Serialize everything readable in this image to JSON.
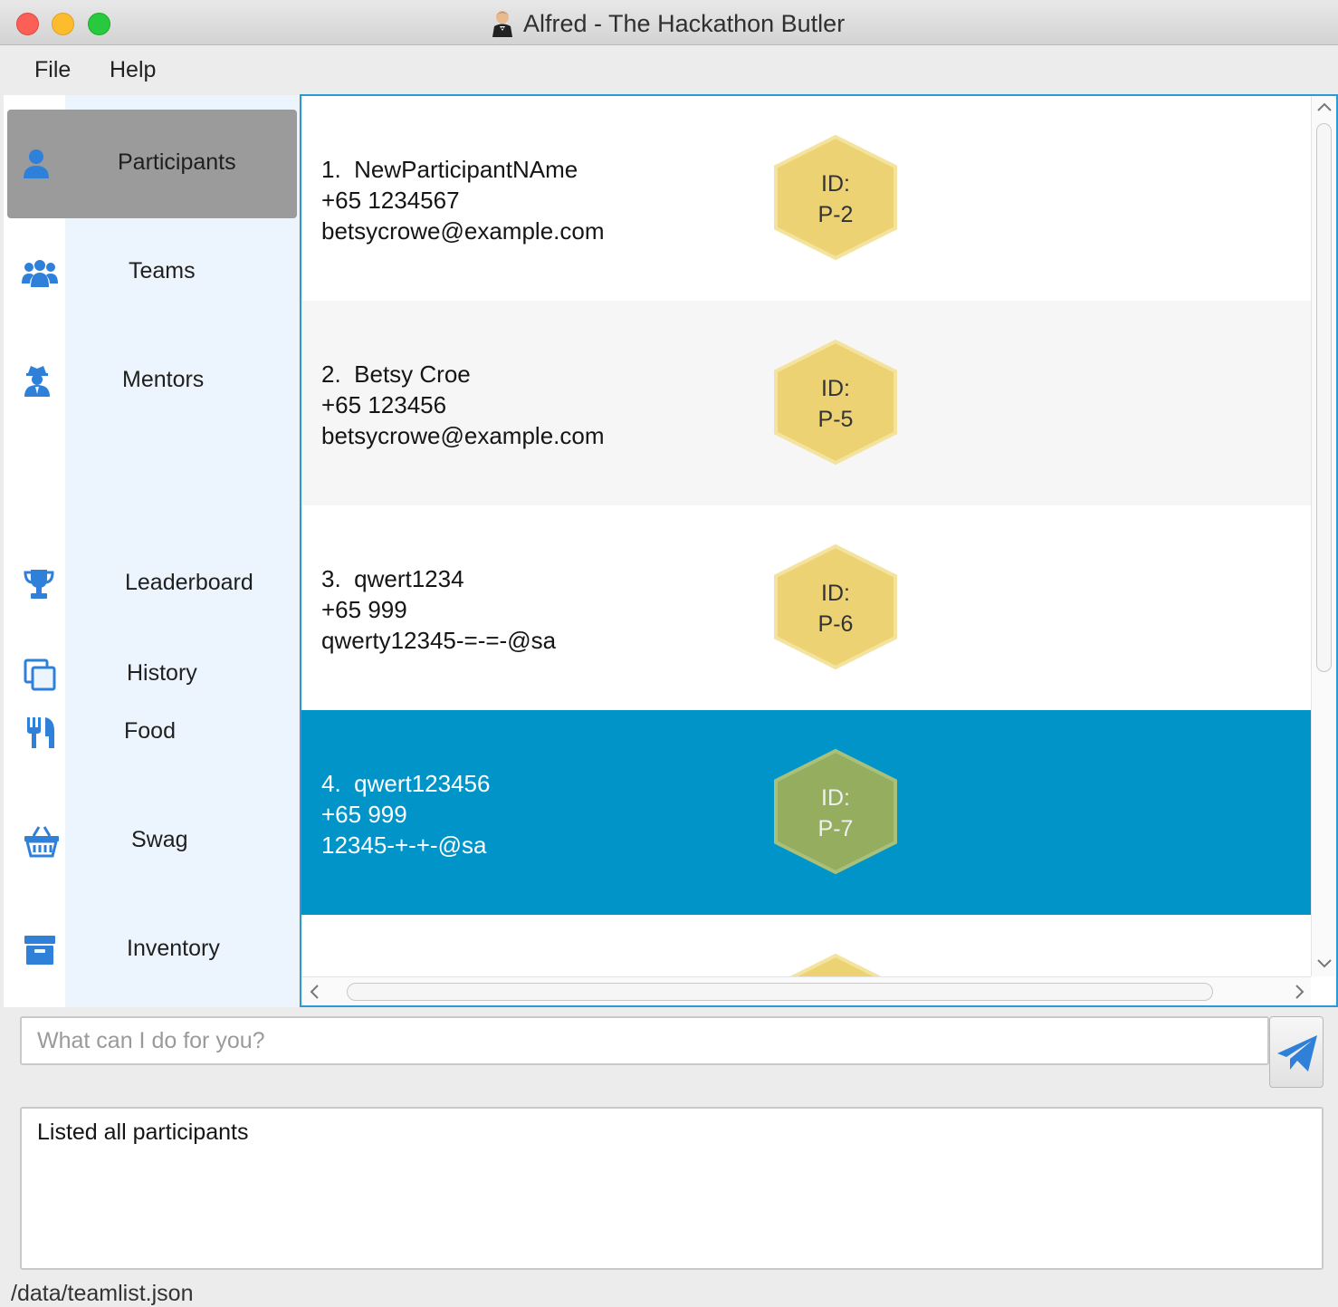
{
  "window": {
    "title": "Alfred - The Hackathon Butler"
  },
  "menu": {
    "file": "File",
    "help": "Help"
  },
  "sidebar": {
    "items": [
      {
        "label": "Participants",
        "icon": "user-icon"
      },
      {
        "label": "Teams",
        "icon": "users-icon"
      },
      {
        "label": "Mentors",
        "icon": "mentor-icon"
      },
      {
        "label": "Leaderboard",
        "icon": "trophy-icon"
      },
      {
        "label": "History",
        "icon": "copy-icon"
      },
      {
        "label": "Food",
        "icon": "utensils-icon"
      },
      {
        "label": "Swag",
        "icon": "basket-icon"
      },
      {
        "label": "Inventory",
        "icon": "archive-icon"
      }
    ]
  },
  "participants": [
    {
      "index": "1.",
      "name": "NewParticipantNAme",
      "phone": "+65 1234567",
      "email": "betsycrowe@example.com",
      "id_label": "ID:",
      "id": "P-2"
    },
    {
      "index": "2.",
      "name": "Betsy Croe",
      "phone": "+65 123456",
      "email": "betsycrowe@example.com",
      "id_label": "ID:",
      "id": "P-5"
    },
    {
      "index": "3.",
      "name": "qwert1234",
      "phone": "+65 999",
      "email": "qwerty12345-=-=-@sa",
      "id_label": "ID:",
      "id": "P-6"
    },
    {
      "index": "4.",
      "name": "qwert123456",
      "phone": "+65 999",
      "email": "12345-+-+-@sa",
      "id_label": "ID:",
      "id": "P-7"
    }
  ],
  "command": {
    "placeholder": "What can I do for you?",
    "value": ""
  },
  "result": {
    "text": "Listed all participants"
  },
  "status": {
    "text": "/data/teamlist.json"
  },
  "colors": {
    "accent": "#0094c9",
    "hex_gold": "#ecd272",
    "hex_selected": "#94ad5e",
    "icon_blue": "#2f80d9"
  }
}
